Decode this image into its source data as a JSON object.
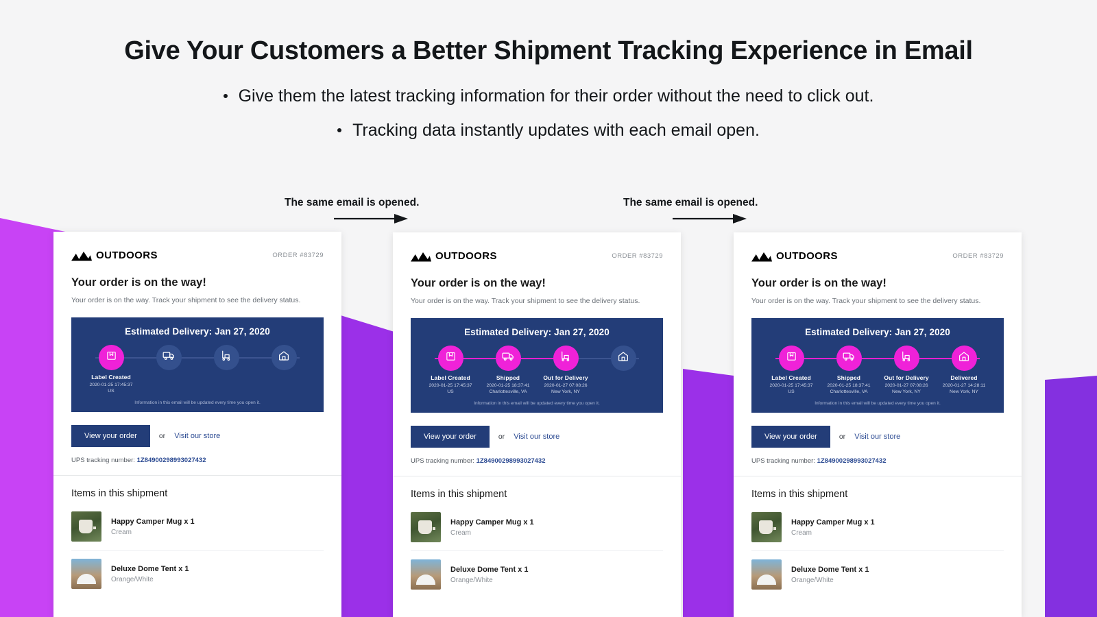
{
  "header": {
    "title": "Give Your Customers a Better Shipment Tracking Experience in Email",
    "bullets": [
      "Give them the latest tracking information for their order without the need to click out.",
      "Tracking data instantly updates with each email open."
    ]
  },
  "flow": {
    "caption_1": "The same email is opened.",
    "caption_2": "The same email is opened."
  },
  "colors": {
    "page_background": "#f5f5f6",
    "shape_magenta": "#c843f5",
    "shape_purple": "#9b30e8",
    "panel_navy": "#233d78",
    "step_active": "#ef22d8",
    "step_inactive": "#34508d",
    "link_blue": "#2b4a92"
  },
  "email": {
    "brand_name": "OUTDOORS",
    "order_number": "ORDER #83729",
    "heading": "Your order is on the way!",
    "subheading": "Your order is on the way. Track your shipment to see the delivery status.",
    "eta": "Estimated Delivery: Jan 27, 2020",
    "note": "Information in this email will be updated every time you open it.",
    "primary_button": "View your order",
    "or_label": "or",
    "store_link": "Visit our store",
    "tracking_label": "UPS tracking number:",
    "tracking_number": "1Z84900298993027432",
    "items_title": "Items in this shipment",
    "items": [
      {
        "name": "Happy Camper Mug x 1",
        "variant": "Cream",
        "thumb": "mug-photo"
      },
      {
        "name": "Deluxe Dome Tent x 1",
        "variant": "Orange/White",
        "thumb": "tent-photo"
      }
    ]
  },
  "tracking_steps": [
    {
      "label": "Label Created",
      "time": "2020-01-25 17:45:37",
      "location": "US",
      "icon": "package-icon"
    },
    {
      "label": "Shipped",
      "time": "2020-01-25 18:37:41",
      "location": "Charlottesville, VA",
      "icon": "truck-icon"
    },
    {
      "label": "Out for Delivery",
      "time": "2020-01-27 07:08:26",
      "location": "New York, NY",
      "icon": "hand-truck-icon"
    },
    {
      "label": "Delivered",
      "time": "2020-01-27 14:28:11",
      "location": "New York, NY",
      "icon": "house-icon"
    }
  ],
  "cards": [
    {
      "id": "card-1",
      "active_steps": 1,
      "visible_steps": 1
    },
    {
      "id": "card-2",
      "active_steps": 3,
      "visible_steps": 3
    },
    {
      "id": "card-3",
      "active_steps": 4,
      "visible_steps": 4
    }
  ]
}
